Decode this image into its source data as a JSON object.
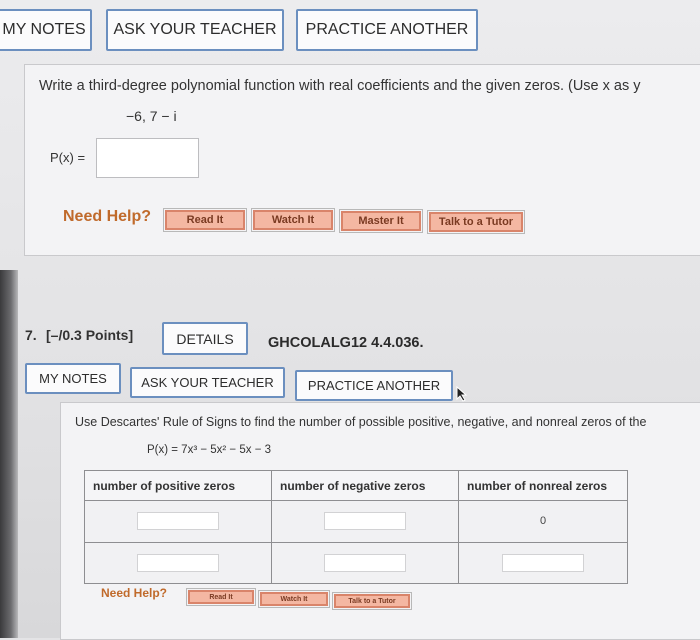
{
  "top_toolbar": {
    "my_notes": "MY NOTES",
    "ask_teacher": "ASK YOUR TEACHER",
    "practice_another": "PRACTICE ANOTHER"
  },
  "q6": {
    "prompt": "Write a third-degree polynomial function with real coefficients and the given zeros. (Use x as y",
    "zeros": "−6, 7 − i",
    "px_label": "P(x)  =",
    "answer_value": "",
    "need_help": "Need Help?",
    "help_buttons": [
      "Read It",
      "Watch It",
      "Master It",
      "Talk to a Tutor"
    ]
  },
  "q7": {
    "number": "7.",
    "points": "[–/0.3 Points]",
    "details": "DETAILS",
    "code": "GHCOLALG12 4.4.036.",
    "toolbar": {
      "my_notes": "MY NOTES",
      "ask_teacher": "ASK YOUR TEACHER",
      "practice_another": "PRACTICE ANOTHER"
    },
    "prompt": "Use Descartes' Rule of Signs to find the number of possible positive, negative, and nonreal zeros of the",
    "equation": "P(x) = 7x³ − 5x² − 5x − 3",
    "table": {
      "headers": [
        "number of positive zeros",
        "number of negative zeros",
        "number of nonreal zeros"
      ],
      "rows": [
        [
          "",
          "",
          "0"
        ],
        [
          "",
          "",
          ""
        ]
      ]
    },
    "need_help": "Need Help?",
    "help_buttons": [
      "Read It",
      "Watch It",
      "Talk to a Tutor"
    ]
  }
}
